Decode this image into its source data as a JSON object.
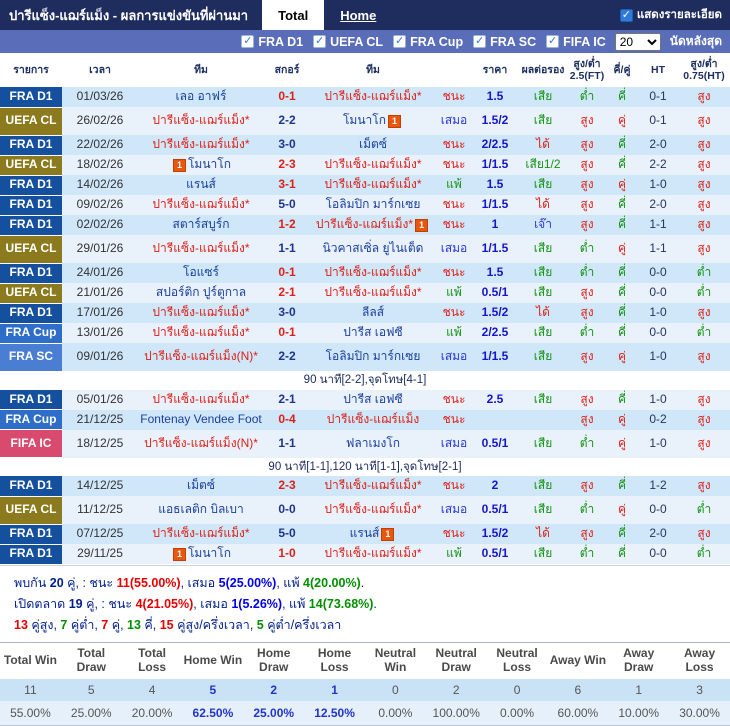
{
  "header": {
    "title": "ปารีแซ็ง-แฌร์แม็ง - ผลการแข่งขันที่ผ่านมา",
    "tabs": [
      {
        "label": "Total",
        "active": true
      },
      {
        "label": "Home",
        "active": false
      }
    ],
    "show_details_label": "แสดงรายละเอียด"
  },
  "filter": {
    "leagues": [
      "FRA D1",
      "UEFA CL",
      "FRA Cup",
      "FRA SC",
      "FIFA IC"
    ],
    "count": "20",
    "count_label": "นัดหลังสุด"
  },
  "table": {
    "headers": [
      "รายการ",
      "เวลา",
      "ทีม",
      "สกอร์",
      "ทีม",
      "",
      "ราคา",
      "ผลต่อรอง",
      "สูง/ต่ำ 2.5(FT)",
      "คี่/คู่",
      "HT",
      "สูง/ต่ำ 0.75(HT)"
    ],
    "rows": [
      {
        "lg": "FRA D1",
        "lc": "d1",
        "date": "01/03/26",
        "h": {
          "t": "เลอ อาฟร์",
          "c": "opp"
        },
        "s": {
          "t": "0-1",
          "c": "sr"
        },
        "a": {
          "t": "ปารีแซ็ง-แฌร์แม็ง*",
          "c": "psg"
        },
        "r": {
          "t": "ชนะ",
          "c": "w"
        },
        "o": "1.5",
        "hc": {
          "t": "เสีย",
          "c": "g"
        },
        "ou": {
          "t": "ต่ำ",
          "c": "g"
        },
        "oe": {
          "t": "คี่",
          "c": "g"
        },
        "ht": "0-1",
        "oh": {
          "t": "สูง",
          "c": "r"
        }
      },
      {
        "lg": "UEFA CL",
        "lc": "cl",
        "date": "26/02/26",
        "h": {
          "t": "ปารีแซ็ง-แฌร์แม็ง*",
          "c": "psg"
        },
        "s": {
          "t": "2-2",
          "c": "sn"
        },
        "a": {
          "t": "โมนาโก",
          "c": "opp",
          "icon": "after"
        },
        "r": {
          "t": "เสมอ",
          "c": "d"
        },
        "o": "1.5/2",
        "hc": {
          "t": "เสีย",
          "c": "g"
        },
        "ou": {
          "t": "สูง",
          "c": "r"
        },
        "oe": {
          "t": "คู่",
          "c": "r"
        },
        "ht": "0-1",
        "oh": {
          "t": "สูง",
          "c": "r"
        }
      },
      {
        "lg": "FRA D1",
        "lc": "d1",
        "date": "22/02/26",
        "h": {
          "t": "ปารีแซ็ง-แฌร์แม็ง*",
          "c": "psg"
        },
        "s": {
          "t": "3-0",
          "c": "sn"
        },
        "a": {
          "t": "เม็ตซ์",
          "c": "opp"
        },
        "r": {
          "t": "ชนะ",
          "c": "w"
        },
        "o": "2/2.5",
        "hc": {
          "t": "ได้",
          "c": "rd"
        },
        "ou": {
          "t": "สูง",
          "c": "r"
        },
        "oe": {
          "t": "คี่",
          "c": "g"
        },
        "ht": "2-0",
        "oh": {
          "t": "สูง",
          "c": "r"
        }
      },
      {
        "lg": "UEFA CL",
        "lc": "cl",
        "date": "18/02/26",
        "h": {
          "t": "โมนาโก",
          "c": "opp",
          "icon": "before"
        },
        "s": {
          "t": "2-3",
          "c": "sr"
        },
        "a": {
          "t": "ปารีแซ็ง-แฌร์แม็ง*",
          "c": "psg"
        },
        "r": {
          "t": "ชนะ",
          "c": "w"
        },
        "o": "1/1.5",
        "hc": {
          "t": "เสีย1/2",
          "c": "g"
        },
        "ou": {
          "t": "สูง",
          "c": "r"
        },
        "oe": {
          "t": "คี่",
          "c": "g"
        },
        "ht": "2-2",
        "oh": {
          "t": "สูง",
          "c": "r"
        }
      },
      {
        "lg": "FRA D1",
        "lc": "d1",
        "date": "14/02/26",
        "h": {
          "t": "แรนส์",
          "c": "opp"
        },
        "s": {
          "t": "3-1",
          "c": "sr"
        },
        "a": {
          "t": "ปารีแซ็ง-แฌร์แม็ง*",
          "c": "psg"
        },
        "r": {
          "t": "แพ้",
          "c": "l"
        },
        "o": "1.5",
        "hc": {
          "t": "เสีย",
          "c": "g"
        },
        "ou": {
          "t": "สูง",
          "c": "r"
        },
        "oe": {
          "t": "คู่",
          "c": "r"
        },
        "ht": "1-0",
        "oh": {
          "t": "สูง",
          "c": "r"
        }
      },
      {
        "lg": "FRA D1",
        "lc": "d1",
        "date": "09/02/26",
        "h": {
          "t": "ปารีแซ็ง-แฌร์แม็ง*",
          "c": "psg"
        },
        "s": {
          "t": "5-0",
          "c": "sn"
        },
        "a": {
          "t": "โอลิมปิก มาร์กเซย",
          "c": "opp"
        },
        "r": {
          "t": "ชนะ",
          "c": "w"
        },
        "o": "1/1.5",
        "hc": {
          "t": "ได้",
          "c": "rd"
        },
        "ou": {
          "t": "สูง",
          "c": "r"
        },
        "oe": {
          "t": "คี่",
          "c": "g"
        },
        "ht": "2-0",
        "oh": {
          "t": "สูง",
          "c": "r"
        }
      },
      {
        "lg": "FRA D1",
        "lc": "d1",
        "date": "02/02/26",
        "h": {
          "t": "สตาร์สบูร์ก",
          "c": "opp"
        },
        "s": {
          "t": "1-2",
          "c": "sr"
        },
        "a": {
          "t": "ปารีแซ็ง-แฌร์แม็ง*",
          "c": "psg",
          "icon": "after"
        },
        "r": {
          "t": "ชนะ",
          "c": "w"
        },
        "o": "1",
        "hc": {
          "t": "เจ๊า",
          "c": "b"
        },
        "ou": {
          "t": "สูง",
          "c": "r"
        },
        "oe": {
          "t": "คี่",
          "c": "g"
        },
        "ht": "1-1",
        "oh": {
          "t": "สูง",
          "c": "r"
        }
      },
      {
        "lg": "UEFA CL",
        "lc": "cl",
        "date": "29/01/26",
        "h": {
          "t": "ปารีแซ็ง-แฌร์แม็ง*",
          "c": "psg"
        },
        "s": {
          "t": "1-1",
          "c": "sn"
        },
        "a": {
          "t": "นิวคาสเซิ่ล ยูไนเต็ด",
          "c": "opp"
        },
        "r": {
          "t": "เสมอ",
          "c": "d"
        },
        "o": "1/1.5",
        "hc": {
          "t": "เสีย",
          "c": "g"
        },
        "ou": {
          "t": "ต่ำ",
          "c": "g"
        },
        "oe": {
          "t": "คู่",
          "c": "r"
        },
        "ht": "1-1",
        "oh": {
          "t": "สูง",
          "c": "r"
        }
      },
      {
        "lg": "FRA D1",
        "lc": "d1",
        "date": "24/01/26",
        "h": {
          "t": "โอแซร์",
          "c": "opp"
        },
        "s": {
          "t": "0-1",
          "c": "sr"
        },
        "a": {
          "t": "ปารีแซ็ง-แฌร์แม็ง*",
          "c": "psg"
        },
        "r": {
          "t": "ชนะ",
          "c": "w"
        },
        "o": "1.5",
        "hc": {
          "t": "เสีย",
          "c": "g"
        },
        "ou": {
          "t": "ต่ำ",
          "c": "g"
        },
        "oe": {
          "t": "คี่",
          "c": "g"
        },
        "ht": "0-0",
        "oh": {
          "t": "ต่ำ",
          "c": "g"
        }
      },
      {
        "lg": "UEFA CL",
        "lc": "cl",
        "date": "21/01/26",
        "h": {
          "t": "สปอร์ติก ปูร์ตูกาล",
          "c": "opp"
        },
        "s": {
          "t": "2-1",
          "c": "sr"
        },
        "a": {
          "t": "ปารีแซ็ง-แฌร์แม็ง*",
          "c": "psg"
        },
        "r": {
          "t": "แพ้",
          "c": "l"
        },
        "o": "0.5/1",
        "hc": {
          "t": "เสีย",
          "c": "g"
        },
        "ou": {
          "t": "สูง",
          "c": "r"
        },
        "oe": {
          "t": "คี่",
          "c": "g"
        },
        "ht": "0-0",
        "oh": {
          "t": "ต่ำ",
          "c": "g"
        }
      },
      {
        "lg": "FRA D1",
        "lc": "d1",
        "date": "17/01/26",
        "h": {
          "t": "ปารีแซ็ง-แฌร์แม็ง*",
          "c": "psg"
        },
        "s": {
          "t": "3-0",
          "c": "sn"
        },
        "a": {
          "t": "ลีลส์",
          "c": "opp"
        },
        "r": {
          "t": "ชนะ",
          "c": "w"
        },
        "o": "1.5/2",
        "hc": {
          "t": "ได้",
          "c": "rd"
        },
        "ou": {
          "t": "สูง",
          "c": "r"
        },
        "oe": {
          "t": "คี่",
          "c": "g"
        },
        "ht": "1-0",
        "oh": {
          "t": "สูง",
          "c": "r"
        }
      },
      {
        "lg": "FRA Cup",
        "lc": "cup",
        "date": "13/01/26",
        "h": {
          "t": "ปารีแซ็ง-แฌร์แม็ง*",
          "c": "psg"
        },
        "s": {
          "t": "0-1",
          "c": "sr"
        },
        "a": {
          "t": "ปารีส เอฟซี",
          "c": "opp"
        },
        "r": {
          "t": "แพ้",
          "c": "l"
        },
        "o": "2/2.5",
        "hc": {
          "t": "เสีย",
          "c": "g"
        },
        "ou": {
          "t": "ต่ำ",
          "c": "g"
        },
        "oe": {
          "t": "คี่",
          "c": "g"
        },
        "ht": "0-0",
        "oh": {
          "t": "ต่ำ",
          "c": "g"
        }
      },
      {
        "lg": "FRA SC",
        "lc": "sc",
        "date": "09/01/26",
        "h": {
          "t": "ปารีแซ็ง-แฌร์แม็ง(N)*",
          "c": "psg"
        },
        "s": {
          "t": "2-2",
          "c": "sn"
        },
        "a": {
          "t": "โอลิมปิก มาร์กเซย",
          "c": "opp"
        },
        "r": {
          "t": "เสมอ",
          "c": "d"
        },
        "o": "1/1.5",
        "hc": {
          "t": "เสีย",
          "c": "g"
        },
        "ou": {
          "t": "สูง",
          "c": "r"
        },
        "oe": {
          "t": "คู่",
          "c": "r"
        },
        "ht": "1-0",
        "oh": {
          "t": "สูง",
          "c": "r"
        },
        "note": "90 นาที[2-2],จุดโทษ[4-1]"
      },
      {
        "lg": "FRA D1",
        "lc": "d1",
        "date": "05/01/26",
        "h": {
          "t": "ปารีแซ็ง-แฌร์แม็ง*",
          "c": "psg"
        },
        "s": {
          "t": "2-1",
          "c": "sn"
        },
        "a": {
          "t": "ปารีส เอฟซี",
          "c": "opp"
        },
        "r": {
          "t": "ชนะ",
          "c": "w"
        },
        "o": "2.5",
        "hc": {
          "t": "เสีย",
          "c": "g"
        },
        "ou": {
          "t": "สูง",
          "c": "r"
        },
        "oe": {
          "t": "คี่",
          "c": "g"
        },
        "ht": "1-0",
        "oh": {
          "t": "สูง",
          "c": "r"
        }
      },
      {
        "lg": "FRA Cup",
        "lc": "cup",
        "date": "21/12/25",
        "h": {
          "t": "Fontenay Vendee Foot",
          "c": "opp"
        },
        "s": {
          "t": "0-4",
          "c": "sr"
        },
        "a": {
          "t": "ปารีแซ็ง-แฌร์แม็ง",
          "c": "psg"
        },
        "r": {
          "t": "ชนะ",
          "c": "w"
        },
        "o": "",
        "hc": {
          "t": "",
          "c": "g"
        },
        "ou": {
          "t": "สูง",
          "c": "r"
        },
        "oe": {
          "t": "คู่",
          "c": "r"
        },
        "ht": "0-2",
        "oh": {
          "t": "สูง",
          "c": "r"
        }
      },
      {
        "lg": "FIFA IC",
        "lc": "ic",
        "date": "18/12/25",
        "h": {
          "t": "ปารีแซ็ง-แฌร์แม็ง(N)*",
          "c": "psg"
        },
        "s": {
          "t": "1-1",
          "c": "sn"
        },
        "a": {
          "t": "ฟลาเมงโก",
          "c": "opp"
        },
        "r": {
          "t": "เสมอ",
          "c": "d"
        },
        "o": "0.5/1",
        "hc": {
          "t": "เสีย",
          "c": "g"
        },
        "ou": {
          "t": "ต่ำ",
          "c": "g"
        },
        "oe": {
          "t": "คู่",
          "c": "r"
        },
        "ht": "1-0",
        "oh": {
          "t": "สูง",
          "c": "r"
        },
        "note": "90 นาที[1-1],120 นาที[1-1],จุดโทษ[2-1]"
      },
      {
        "lg": "FRA D1",
        "lc": "d1",
        "date": "14/12/25",
        "h": {
          "t": "เม็ตซ์",
          "c": "opp"
        },
        "s": {
          "t": "2-3",
          "c": "sr"
        },
        "a": {
          "t": "ปารีแซ็ง-แฌร์แม็ง*",
          "c": "psg"
        },
        "r": {
          "t": "ชนะ",
          "c": "w"
        },
        "o": "2",
        "hc": {
          "t": "เสีย",
          "c": "g"
        },
        "ou": {
          "t": "สูง",
          "c": "r"
        },
        "oe": {
          "t": "คี่",
          "c": "g"
        },
        "ht": "1-2",
        "oh": {
          "t": "สูง",
          "c": "r"
        }
      },
      {
        "lg": "UEFA CL",
        "lc": "cl",
        "date": "11/12/25",
        "h": {
          "t": "แอธเลติก บิลเบา",
          "c": "opp"
        },
        "s": {
          "t": "0-0",
          "c": "sn"
        },
        "a": {
          "t": "ปารีแซ็ง-แฌร์แม็ง*",
          "c": "psg"
        },
        "r": {
          "t": "เสมอ",
          "c": "d"
        },
        "o": "0.5/1",
        "hc": {
          "t": "เสีย",
          "c": "g"
        },
        "ou": {
          "t": "ต่ำ",
          "c": "g"
        },
        "oe": {
          "t": "คู่",
          "c": "r"
        },
        "ht": "0-0",
        "oh": {
          "t": "ต่ำ",
          "c": "g"
        }
      },
      {
        "lg": "FRA D1",
        "lc": "d1",
        "date": "07/12/25",
        "h": {
          "t": "ปารีแซ็ง-แฌร์แม็ง*",
          "c": "psg"
        },
        "s": {
          "t": "5-0",
          "c": "sn"
        },
        "a": {
          "t": "แรนส์",
          "c": "opp",
          "icon": "after"
        },
        "r": {
          "t": "ชนะ",
          "c": "w"
        },
        "o": "1.5/2",
        "hc": {
          "t": "ได้",
          "c": "rd"
        },
        "ou": {
          "t": "สูง",
          "c": "r"
        },
        "oe": {
          "t": "คี่",
          "c": "g"
        },
        "ht": "2-0",
        "oh": {
          "t": "สูง",
          "c": "r"
        }
      },
      {
        "lg": "FRA D1",
        "lc": "d1",
        "date": "29/11/25",
        "h": {
          "t": "โมนาโก",
          "c": "opp",
          "icon": "before"
        },
        "s": {
          "t": "1-0",
          "c": "sr"
        },
        "a": {
          "t": "ปารีแซ็ง-แฌร์แม็ง*",
          "c": "psg"
        },
        "r": {
          "t": "แพ้",
          "c": "l"
        },
        "o": "0.5/1",
        "hc": {
          "t": "เสีย",
          "c": "g"
        },
        "ou": {
          "t": "ต่ำ",
          "c": "g"
        },
        "oe": {
          "t": "คี่",
          "c": "g"
        },
        "ht": "0-0",
        "oh": {
          "t": "ต่ำ",
          "c": "g"
        }
      }
    ]
  },
  "summary": {
    "lines": [
      [
        {
          "t": "พบกัน ",
          "c": "nv"
        },
        {
          "t": "20",
          "c": "nvb"
        },
        {
          "t": " คู่, : ชนะ ",
          "c": "nv"
        },
        {
          "t": "11(55.00%)",
          "c": "rd"
        },
        {
          "t": ", เสมอ ",
          "c": "nv"
        },
        {
          "t": "5(25.00%)",
          "c": "bl"
        },
        {
          "t": ", แพ้ ",
          "c": "nv"
        },
        {
          "t": "4(20.00%)",
          "c": "gr"
        },
        {
          "t": ".",
          "c": "nv"
        }
      ],
      [
        {
          "t": "เปิดตลาด ",
          "c": "nv"
        },
        {
          "t": "19",
          "c": "nvb"
        },
        {
          "t": " คู่, : ชนะ ",
          "c": "nv"
        },
        {
          "t": "4(21.05%)",
          "c": "rd"
        },
        {
          "t": ", เสมอ ",
          "c": "nv"
        },
        {
          "t": "1(5.26%)",
          "c": "bl"
        },
        {
          "t": ", แพ้ ",
          "c": "nv"
        },
        {
          "t": "14(73.68%)",
          "c": "gr"
        },
        {
          "t": ".",
          "c": "nv"
        }
      ],
      [
        {
          "t": "13",
          "c": "rd"
        },
        {
          "t": " คู่สูง, ",
          "c": "nv"
        },
        {
          "t": "7",
          "c": "gr"
        },
        {
          "t": " คู่ต่ำ, ",
          "c": "nv"
        },
        {
          "t": "7",
          "c": "rd"
        },
        {
          "t": " คู่, ",
          "c": "nv"
        },
        {
          "t": "13",
          "c": "gr"
        },
        {
          "t": " คี่, ",
          "c": "nv"
        },
        {
          "t": "15",
          "c": "rd"
        },
        {
          "t": " คู่สูง/ครึ่งเวลา, ",
          "c": "nv"
        },
        {
          "t": "5",
          "c": "gr"
        },
        {
          "t": " คู่ต่ำ/ครึ่งเวลา",
          "c": "nv"
        }
      ]
    ]
  },
  "stats": {
    "headers": [
      "Total Win",
      "Total Draw",
      "Total Loss",
      "Home Win",
      "Home Draw",
      "Home Loss",
      "Neutral Win",
      "Neutral Draw",
      "Neutral Loss",
      "Away Win",
      "Away Draw",
      "Away Loss"
    ],
    "counts": [
      "11",
      "5",
      "4",
      "5",
      "2",
      "1",
      "0",
      "2",
      "0",
      "6",
      "1",
      "3"
    ],
    "percents": [
      "55.00%",
      "25.00%",
      "20.00%",
      "62.50%",
      "25.00%",
      "12.50%",
      "0.00%",
      "100.00%",
      "0.00%",
      "60.00%",
      "10.00%",
      "30.00%"
    ],
    "highlight_columns": [
      3,
      4,
      5
    ]
  },
  "colors": {
    "topbar": "#1e2c5e",
    "filterbar": "#5a6db8",
    "league_d1": "#15509e",
    "league_cl": "#8b7b1e",
    "league_cup": "#2e6dc8",
    "league_sc": "#4a7ed2",
    "league_ic": "#d84a6e",
    "rowA": "#cfe7f8",
    "rowB": "#e9f1fb",
    "red": "#dd2119",
    "green": "#149314",
    "blue": "#2936d9",
    "opp": "#1a3f9d",
    "scorenavy": "#20348c",
    "odds": "#1515cc",
    "sumnavy": "#001e8c",
    "sumred": "#e60000",
    "sumblue": "#0000ee",
    "sumgreen": "#009000",
    "homeblue": "#2233cc",
    "statA": "#c9e2f5",
    "statB": "#e6f0fa"
  }
}
